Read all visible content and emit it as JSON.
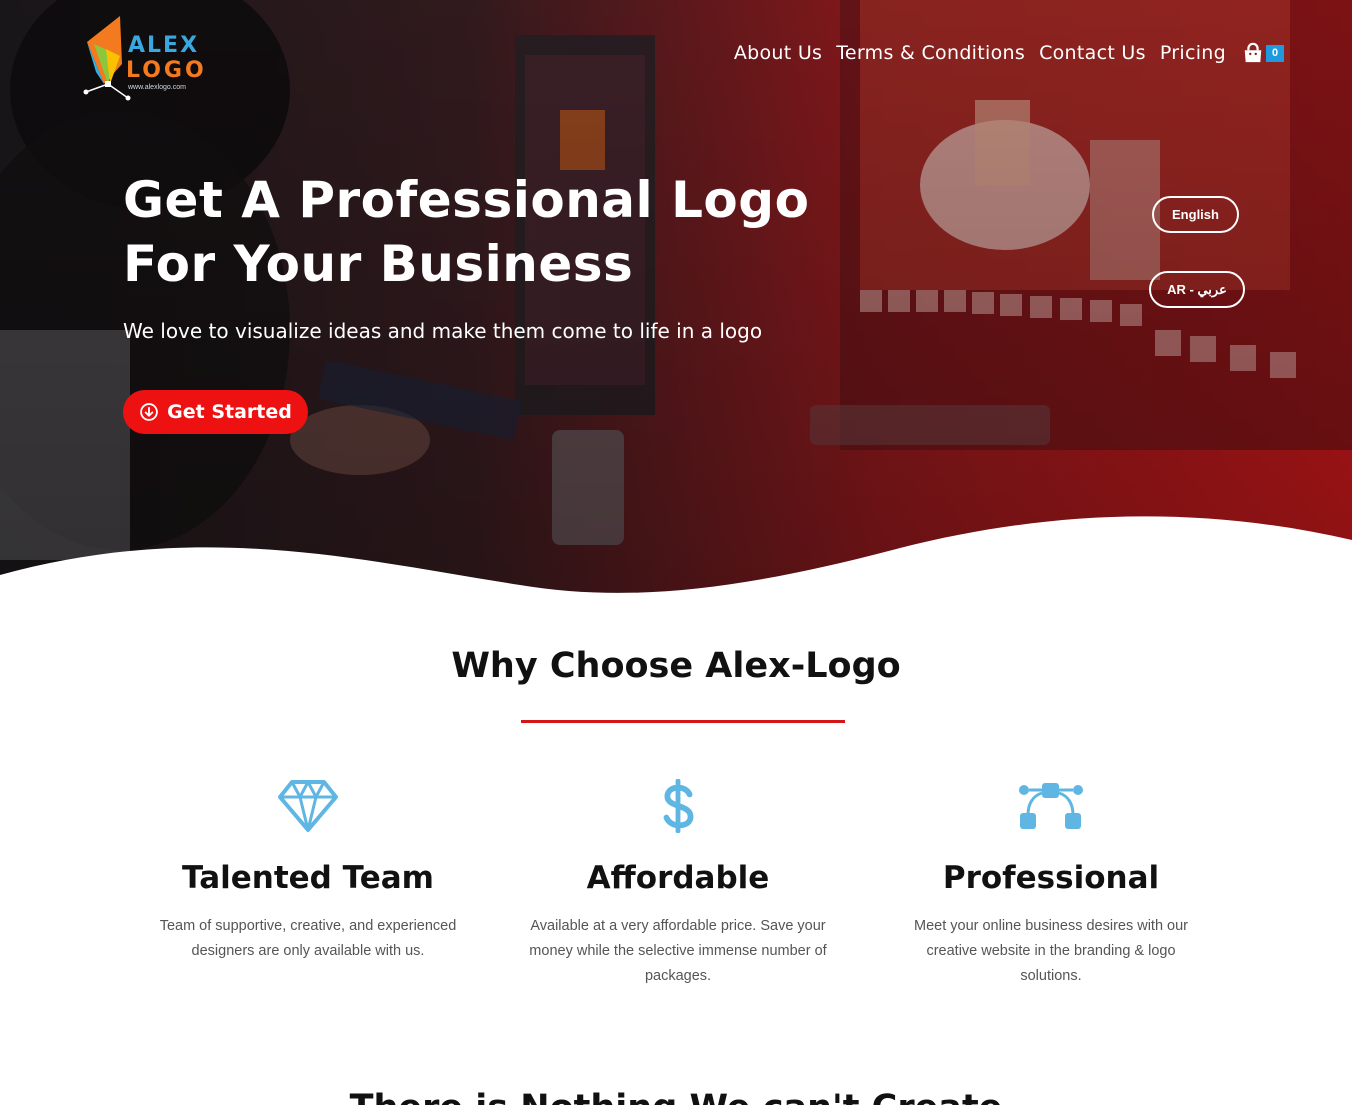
{
  "brand": {
    "name": "Alex Logo",
    "logo_word_1": "ALEX",
    "logo_word_2": "LOGO",
    "logo_url_text": "www.alexlogo.com"
  },
  "nav": {
    "items": [
      {
        "label": "About Us"
      },
      {
        "label": "Terms & Conditions"
      },
      {
        "label": "Contact Us"
      },
      {
        "label": "Pricing"
      }
    ],
    "cart_count": "0",
    "cart_icon": "shopping-bag-icon"
  },
  "hero": {
    "title_line_1": "Get A Professional Logo",
    "title_line_2": "For Your Business",
    "subtitle": "We love to visualize ideas and make them come to life in a logo",
    "cta_label": "Get Started",
    "cta_icon": "arrow-circle-down-icon"
  },
  "language": {
    "english_label": "English",
    "arabic_label": "AR - عربي"
  },
  "why": {
    "title": "Why Choose Alex-Logo",
    "features": [
      {
        "icon": "diamond-icon",
        "title": "Talented Team",
        "text": "Team of supportive, creative, and experienced designers are only available with us."
      },
      {
        "icon": "dollar-icon",
        "title": "Affordable",
        "text": "Available at a very affordable price. Save your money while the selective immense number of packages."
      },
      {
        "icon": "vector-nodes-icon",
        "title": "Professional",
        "text": "Meet your online business desires with our creative website in the branding & logo solutions."
      }
    ]
  },
  "next_section": {
    "title": "There is Nothing We can't Create"
  },
  "colors": {
    "accent": "#ee1111",
    "divider": "#d41616",
    "icon_blue": "#5fb6e3",
    "badge": "#1e9be0"
  }
}
